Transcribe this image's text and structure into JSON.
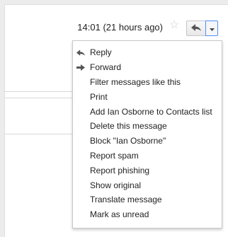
{
  "header": {
    "timestamp": "14:01 (21 hours ago)"
  },
  "icons": {
    "star": "☆",
    "star_icon": "star-icon",
    "reply_icon": "reply-arrow-icon",
    "dropdown_icon": "caret-down-icon"
  },
  "menu": {
    "items": [
      {
        "label": "Reply",
        "icon": "reply-arrow-icon"
      },
      {
        "label": "Forward",
        "icon": "forward-arrow-icon"
      },
      {
        "label": "Filter messages like this"
      },
      {
        "label": "Print"
      },
      {
        "label": "Add Ian Osborne to Contacts list"
      },
      {
        "label": "Delete this message"
      },
      {
        "label": "Block \"Ian Osborne\""
      },
      {
        "label": "Report spam"
      },
      {
        "label": "Report phishing"
      },
      {
        "label": "Show original"
      },
      {
        "label": "Translate message"
      },
      {
        "label": "Mark as unread"
      }
    ]
  },
  "colors": {
    "background": "#ececec",
    "panel": "#ffffff",
    "focus_border": "#4d90fe",
    "icon_gray": "#555555",
    "star_gray": "#d0d0d0"
  }
}
